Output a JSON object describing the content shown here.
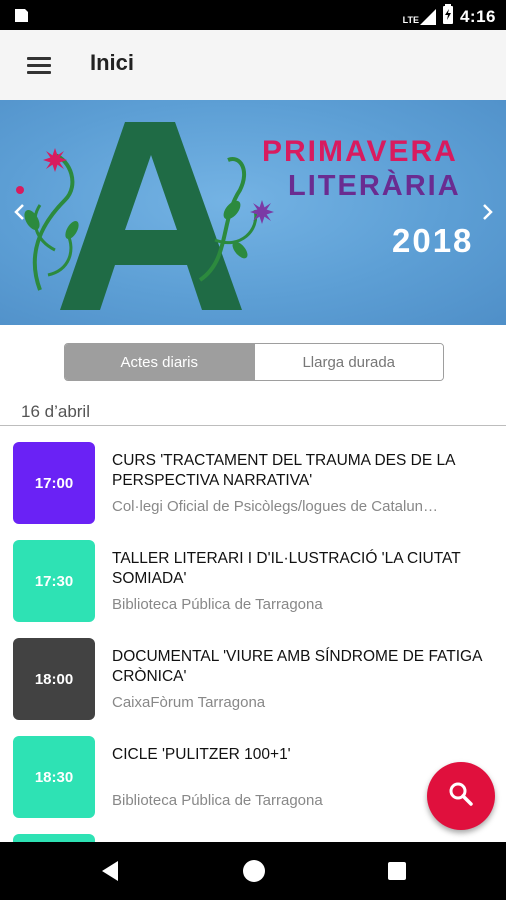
{
  "status_bar": {
    "time": "4:16",
    "network": "LTE"
  },
  "app_bar": {
    "title": "Inici"
  },
  "banner": {
    "letter": "A",
    "title_line1": "PRIMAVERA",
    "title_line2": "LITERÀRIA",
    "year": "2018"
  },
  "tabs": [
    {
      "label": "Actes diaris",
      "active": true
    },
    {
      "label": "Llarga durada",
      "active": false
    }
  ],
  "date_header": "16 d’abril",
  "events": [
    {
      "time": "17:00",
      "color": "#6a22f5",
      "title": "CURS 'TRACTAMENT DEL TRAUMA DES DE LA PERSPECTIVA NARRATIVA'",
      "place": "Col·legi Oficial de Psicòlegs/logues de Catalun…"
    },
    {
      "time": "17:30",
      "color": "#2ee2b4",
      "title": "TALLER LITERARI I D'IL·LUSTRACIÓ 'LA CIUTAT SOMIADA'",
      "place": "Biblioteca Pública de Tarragona"
    },
    {
      "time": "18:00",
      "color": "#424242",
      "title": "DOCUMENTAL 'VIURE AMB SÍNDROME DE FATIGA CRÒNICA'",
      "place": "CaixaFòrum Tarragona"
    },
    {
      "time": "18:30",
      "color": "#2ee2b4",
      "title": "CICLE 'PULITZER 100+1'",
      "place": "Biblioteca Pública de Tarragona"
    }
  ],
  "colors": {
    "accent": "#e0103d",
    "banner_bg": "#5d9fd5"
  },
  "icons": [
    "menu-icon",
    "search-icon",
    "chevron-left-icon",
    "chevron-right-icon",
    "back-icon",
    "home-icon",
    "recents-icon"
  ]
}
